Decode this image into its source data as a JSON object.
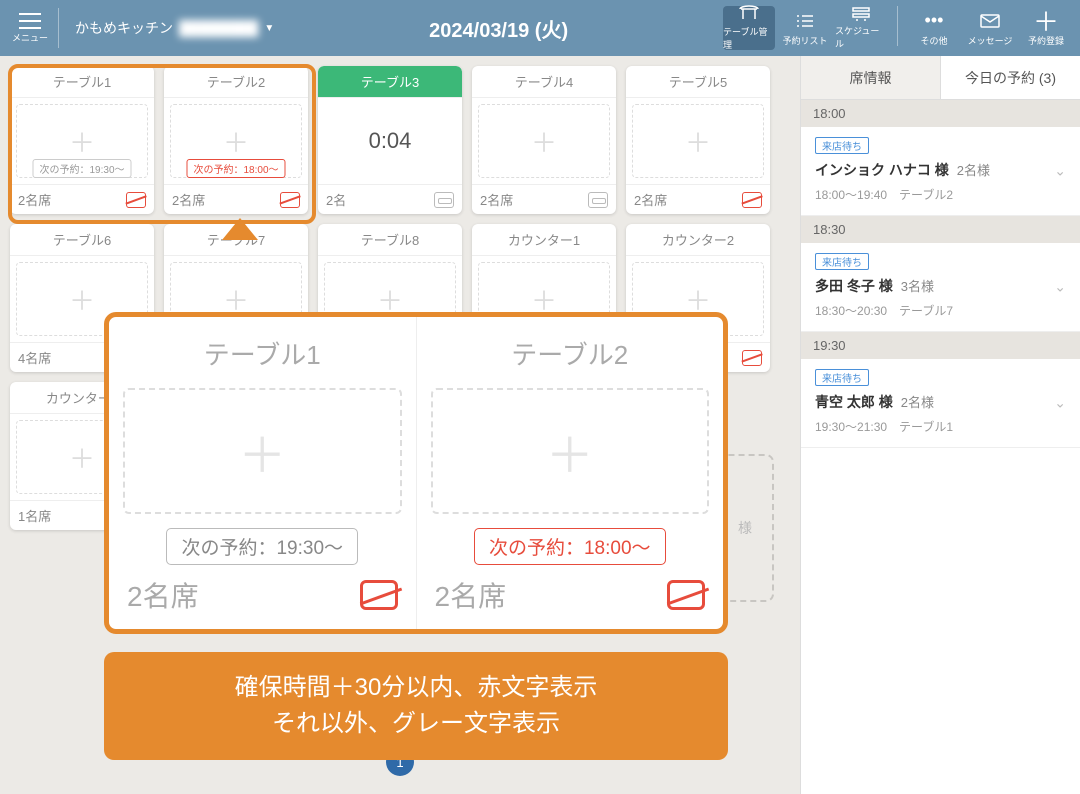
{
  "header": {
    "menu_label": "メニュー",
    "location_name": "かもめキッチン",
    "location_blur": "████████",
    "date": "2024/03/19 (火)",
    "nav": [
      {
        "label": "テーブル管理",
        "icon": "table"
      },
      {
        "label": "予約リスト",
        "icon": "list"
      },
      {
        "label": "スケジュール",
        "icon": "schedule"
      },
      {
        "label": "その他",
        "icon": "dots"
      },
      {
        "label": "メッセージ",
        "icon": "mail"
      },
      {
        "label": "予約登録",
        "icon": "plus"
      }
    ]
  },
  "tables": [
    {
      "name": "テーブル1",
      "seats": "2名席",
      "next": "次の予約：19:30～",
      "next_red": false,
      "smoke": "no"
    },
    {
      "name": "テーブル2",
      "seats": "2名席",
      "next": "次の予約：18:00～",
      "next_red": true,
      "smoke": "no"
    },
    {
      "name": "テーブル3",
      "seats": "2名",
      "timer": "0:04",
      "green": true,
      "smoke": "ok"
    },
    {
      "name": "テーブル4",
      "seats": "2名席",
      "smoke": "ok"
    },
    {
      "name": "テーブル5",
      "seats": "2名席",
      "smoke": "no"
    },
    {
      "name": "テーブル6",
      "seats": "4名席",
      "smoke": "no"
    },
    {
      "name": "テーブル7",
      "seats": "",
      "smoke": ""
    },
    {
      "name": "テーブル8",
      "seats": "",
      "smoke": ""
    },
    {
      "name": "カウンター1",
      "seats": "",
      "smoke": ""
    },
    {
      "name": "カウンター2",
      "seats": "",
      "smoke": "no"
    },
    {
      "name": "カウンター3",
      "seats": "1名席",
      "smoke": ""
    }
  ],
  "zoom": {
    "t1": {
      "title": "テーブル1",
      "next": "次の予約：19:30～",
      "seats": "2名席"
    },
    "t2": {
      "title": "テーブル2",
      "next": "次の予約：18:00～",
      "seats": "2名席"
    }
  },
  "caption_l1": "確保時間＋30分以内、赤文字表示",
  "caption_l2": "それ以外、グレー文字表示",
  "ghost_text": "様",
  "page": "1",
  "side": {
    "tab_seat": "席情報",
    "tab_today": "今日の予約 (3)",
    "groups": [
      {
        "time": "18:00",
        "badge": "来店待ち",
        "name": "インショク ハナコ 様",
        "count": "2名様",
        "detail": "18:00～19:40　テーブル2"
      },
      {
        "time": "18:30",
        "badge": "来店待ち",
        "name": "多田 冬子 様",
        "count": "3名様",
        "detail": "18:30～20:30　テーブル7"
      },
      {
        "time": "19:30",
        "badge": "来店待ち",
        "name": "青空 太郎 様",
        "count": "2名様",
        "detail": "19:30～21:30　テーブル1"
      }
    ]
  }
}
